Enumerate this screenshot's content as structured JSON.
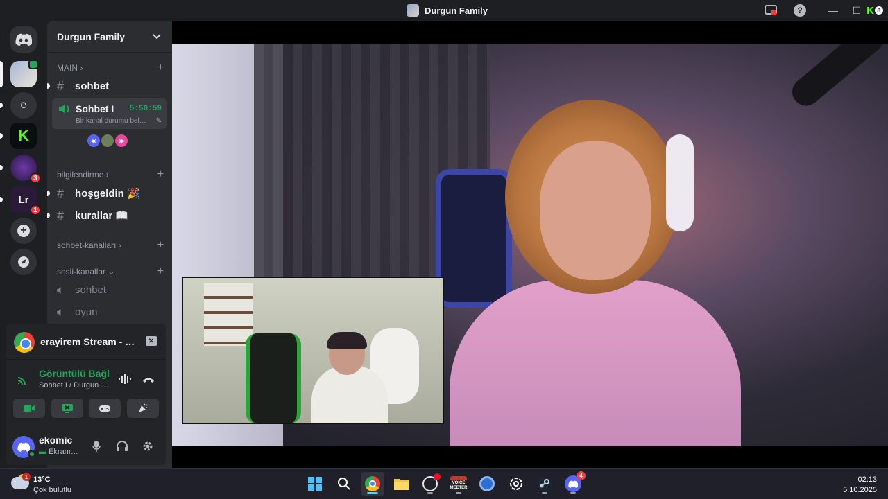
{
  "window": {
    "title": "Durgun Family",
    "controls": {
      "minimize": "—",
      "maximize": "☐",
      "close": "✕"
    },
    "kick_badge": "8"
  },
  "servers": [
    {
      "name": "durgun-family",
      "selected": true
    },
    {
      "name": "e",
      "label": "e"
    },
    {
      "name": "kick",
      "label": "K"
    },
    {
      "name": "server-purple",
      "badge": "3"
    },
    {
      "name": "server-lr",
      "badge": "1"
    }
  ],
  "sidebar": {
    "guild_name": "Durgun Family",
    "categories": {
      "main": "MAIN",
      "bilgilendirme": "bilgilendirme",
      "sohbet_kanallari": "sohbet-kanalları",
      "sesli_kanallar": "sesli-kanallar"
    },
    "channels": {
      "sohbet": "sohbet",
      "voice_active": "Sohbet I",
      "voice_timer": "5:50:59",
      "voice_status": "Bir kanal durumu bel…",
      "hosgeldin": "hoşgeldin 🎉",
      "kurallar": "kurallar 📖",
      "voice_sohbet": "sohbet",
      "voice_oyun": "oyun"
    }
  },
  "stream_panel": {
    "title": "erayirem Stream - …",
    "voice_connected": "Görüntülü Bağl",
    "voice_location": "Sohbet I / Durgun …"
  },
  "user": {
    "name": "ekomic",
    "status": "Ekranı…"
  },
  "taskbar": {
    "weather_temp": "13°C",
    "weather_cond": "Çok bulutlu",
    "weather_badge": "1",
    "discord_badge": "4",
    "time": "02:13",
    "date": "5.10.2025",
    "voicemeeter_label": "VOICE MEETER"
  },
  "colors": {
    "accent_green": "#23a55a",
    "discord_blurple": "#5865f2",
    "kick_green": "#53fc18",
    "badge_red": "#f23f43"
  }
}
